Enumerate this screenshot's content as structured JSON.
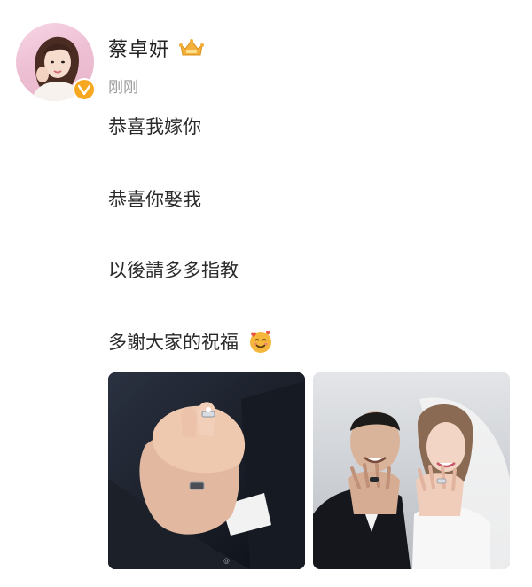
{
  "post": {
    "username": "蔡卓妍",
    "timestamp": "刚刚",
    "lines": [
      "恭喜我嫁你",
      "恭喜你娶我",
      "以後請多多指教",
      "多謝大家的祝福"
    ],
    "icons": {
      "avatar": "avatar-photo",
      "verified": "verified-badge-icon",
      "crown": "crown-badge-icon",
      "emoji": "smiling-face-with-hearts-emoji"
    },
    "photos": [
      {
        "name": "photo-holding-hands-rings"
      },
      {
        "name": "photo-couple-showing-rings"
      }
    ]
  },
  "colors": {
    "verified": "#f6a821",
    "crown": "#f3b13c",
    "timestamp": "#9a9a9a",
    "text": "#2a2a2a"
  }
}
